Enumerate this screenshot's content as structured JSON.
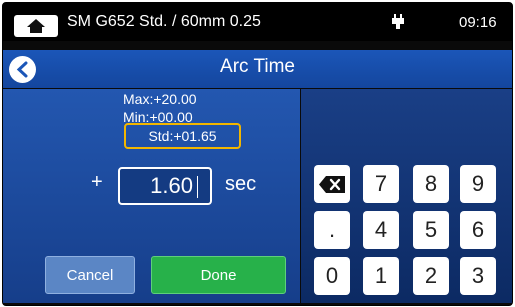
{
  "top_bar": {
    "title": "SM G652 Std. / 60mm 0.25",
    "time": "09:16",
    "icons": [
      "home-icon",
      "power-plug-icon"
    ]
  },
  "header": {
    "title": "Arc Time",
    "back_icon": "chevron-left-icon"
  },
  "range": {
    "max": "Max:+20.00",
    "min": "Min:+00.00",
    "std": "Std:+01.65"
  },
  "input": {
    "sign": "+",
    "value": "1.60",
    "unit": "sec"
  },
  "buttons": {
    "cancel": "Cancel",
    "done": "Done"
  },
  "keypad": {
    "backspace_icon": "backspace-icon",
    "keys": [
      "7",
      "8",
      "9",
      ".",
      "4",
      "5",
      "6",
      "0",
      "1",
      "2",
      "3"
    ]
  },
  "colors": {
    "highlight": "#f2b600",
    "done": "#27b14a",
    "cancel": "#5b86c5",
    "header": "#1b56b8"
  }
}
